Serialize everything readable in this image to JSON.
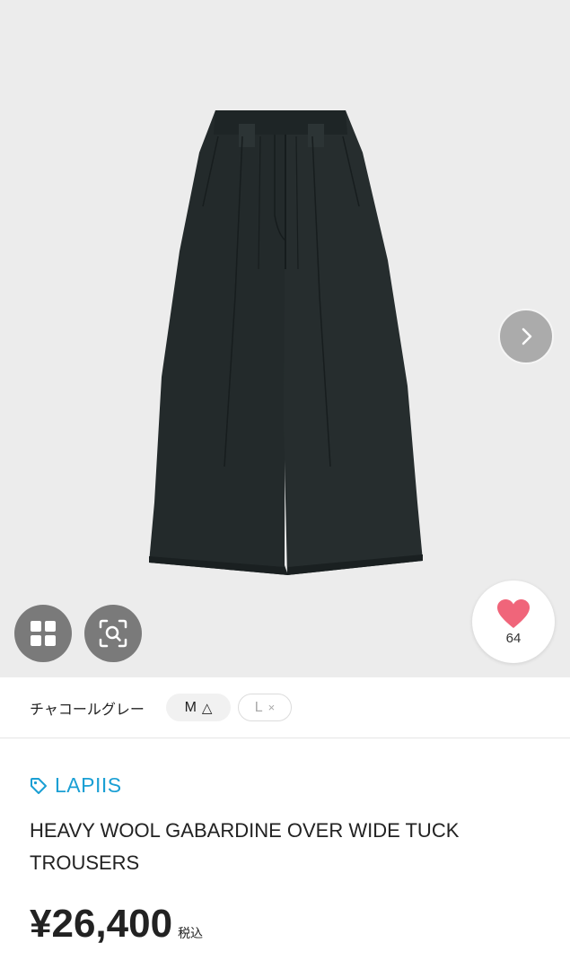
{
  "product_image": {
    "subject": "trousers"
  },
  "gallery": {
    "next_icon": "chevron-right-icon",
    "grid_icon": "grid-icon",
    "zoom_icon": "image-search-icon"
  },
  "like": {
    "icon": "heart-icon",
    "count": "64",
    "color": "#f0657a"
  },
  "variants": {
    "color_name": "チャコールグレー",
    "sizes": [
      {
        "label": "M",
        "mark": "△"
      },
      {
        "label": "L",
        "mark": "×"
      }
    ]
  },
  "product": {
    "brand": "LAPIIS",
    "brand_icon": "tag-icon",
    "brand_color": "#1a9fd4",
    "title": "HEAVY WOOL GABARDINE OVER WIDE TUCK TROUSERS",
    "price": "¥26,400",
    "tax_note": "税込"
  }
}
